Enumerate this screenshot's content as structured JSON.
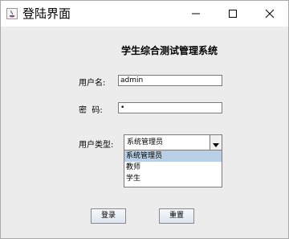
{
  "window": {
    "title": "登陆界面",
    "icon": "java-app-icon",
    "controls": [
      "minimize-icon",
      "maximize-icon",
      "close-icon"
    ]
  },
  "form": {
    "system_title": "学生综合测试管理系统",
    "username_label": "用户名:",
    "username_value": "admin",
    "password_label": "密  码:",
    "password_value": "•",
    "user_type_label": "用户类型:",
    "user_type_selected": "系统管理员",
    "user_type_options": [
      "系统管理员",
      "教师",
      "学生"
    ]
  },
  "buttons": {
    "login": "登录",
    "reset": "重置"
  },
  "colors": {
    "selected_option": "#b8cfe5",
    "window_bg": "#ececec"
  }
}
